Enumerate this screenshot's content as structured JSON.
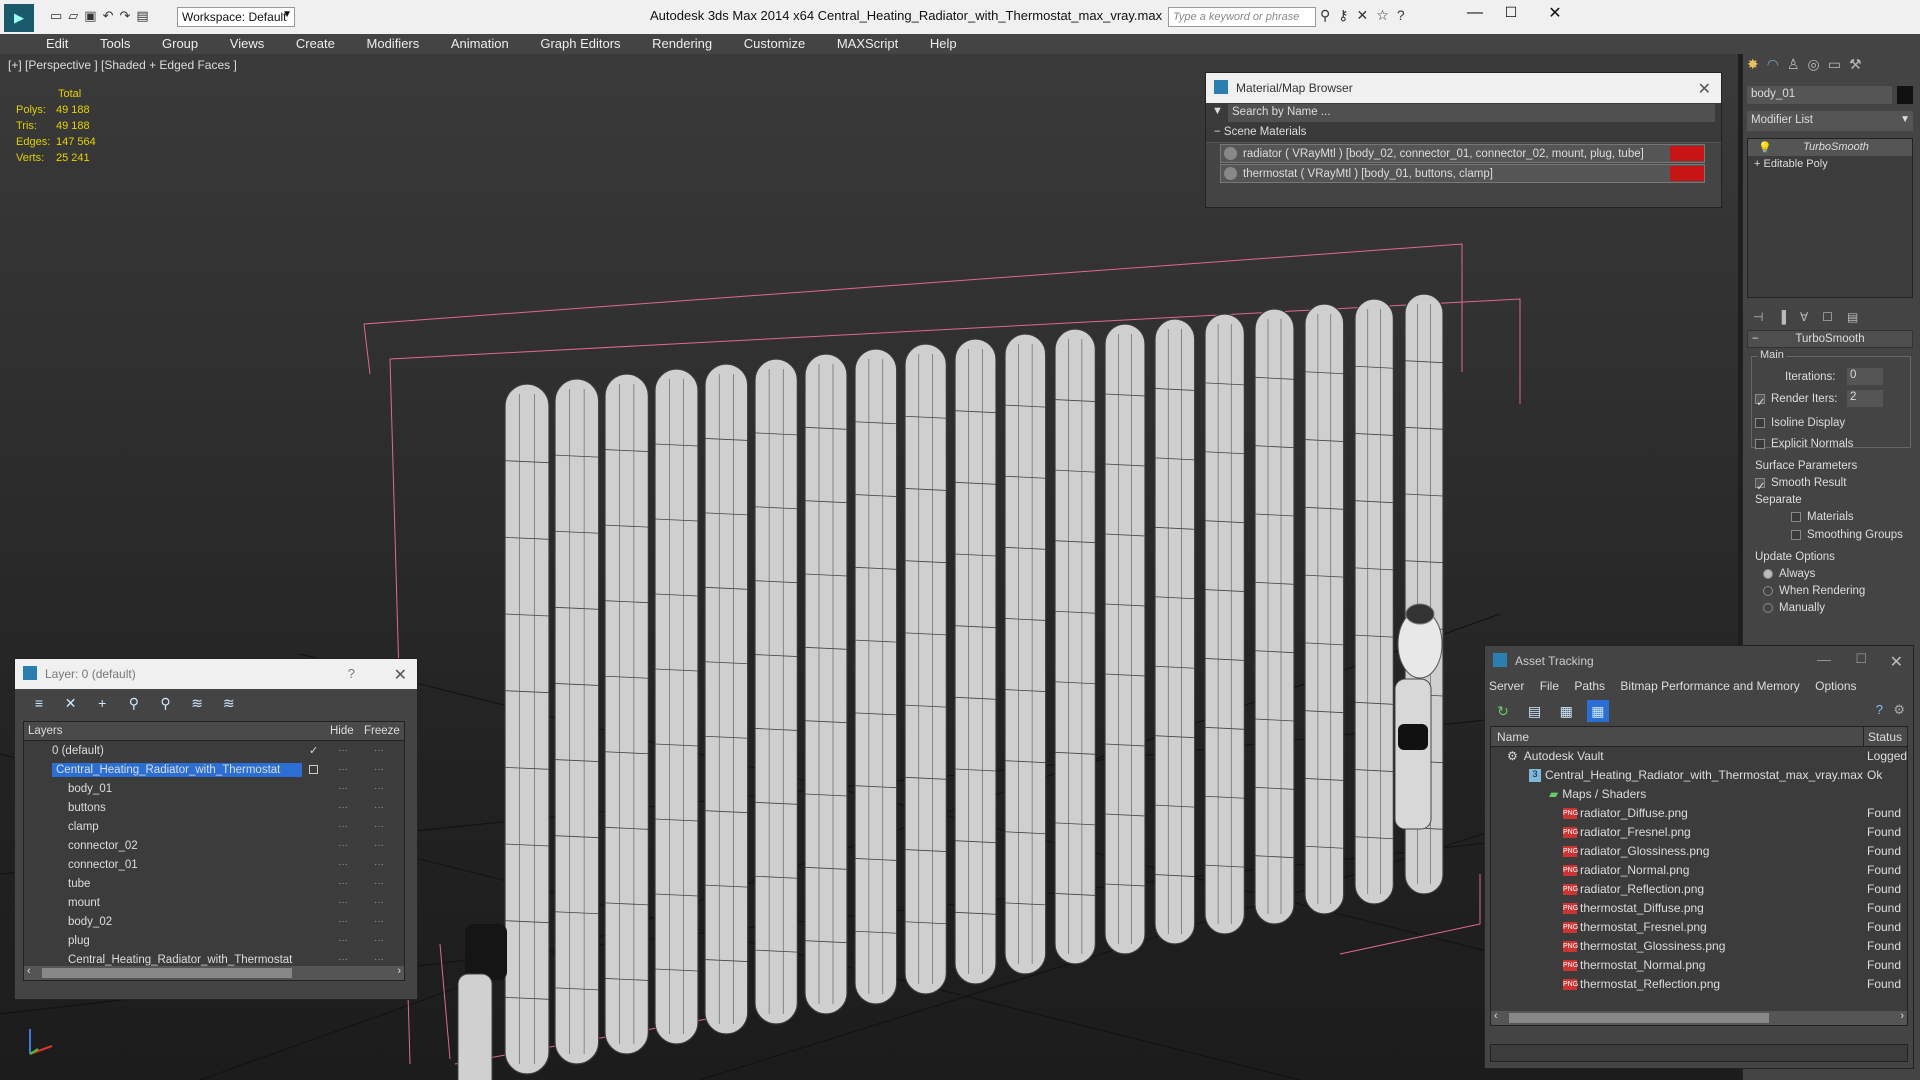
{
  "window": {
    "title": "Autodesk 3ds Max  2014 x64      Central_Heating_Radiator_with_Thermostat_max_vray.max",
    "workspace": "Workspace: Default",
    "search_placeholder": "Type a keyword or phrase"
  },
  "menu": [
    "Edit",
    "Tools",
    "Group",
    "Views",
    "Create",
    "Modifiers",
    "Animation",
    "Graph Editors",
    "Rendering",
    "Customize",
    "MAXScript",
    "Help"
  ],
  "viewport": {
    "label": "[+] [Perspective ] [Shaded + Edged Faces ]",
    "stats": {
      "header": "Total",
      "rows": [
        {
          "k": "Polys:",
          "v": "49 188"
        },
        {
          "k": "Tris:",
          "v": "49 188"
        },
        {
          "k": "Edges:",
          "v": "147 564"
        },
        {
          "k": "Verts:",
          "v": "25 241"
        }
      ]
    }
  },
  "material_browser": {
    "title": "Material/Map Browser",
    "search": "Search by Name ...",
    "section": "Scene Materials",
    "items": [
      "radiator  ( VRayMtl )  [body_02, connector_01, connector_02, mount, plug, tube]",
      "thermostat  ( VRayMtl )  [body_01, buttons, clamp]"
    ],
    "swatch_color": "#c81414"
  },
  "layer_panel": {
    "title": "Layer: 0 (default)",
    "help": "?",
    "col_layers": "Layers",
    "col_hide": "Hide",
    "col_freeze": "Freeze",
    "rows": [
      "0 (default)",
      "Central_Heating_Radiator_with_Thermostat",
      "body_01",
      "buttons",
      "clamp",
      "connector_02",
      "connector_01",
      "tube",
      "mount",
      "body_02",
      "plug",
      "Central_Heating_Radiator_with_Thermostat"
    ]
  },
  "command_panel": {
    "object_name": "body_01",
    "modifier_list": "Modifier List",
    "stack": [
      "TurboSmooth",
      "Editable Poly"
    ],
    "rollout": "TurboSmooth",
    "main": "Main",
    "iterations_label": "Iterations:",
    "iterations": "0",
    "render_iters_label": "Render Iters:",
    "render_iters": "2",
    "isoline": "Isoline Display",
    "explicit": "Explicit Normals",
    "surface": "Surface Parameters",
    "smooth_result": "Smooth Result",
    "separate": "Separate",
    "materials": "Materials",
    "smoothing_groups": "Smoothing Groups",
    "update": "Update Options",
    "always": "Always",
    "when_rendering": "When Rendering",
    "manually": "Manually"
  },
  "asset_tracking": {
    "title": "Asset Tracking",
    "menu": [
      "Server",
      "File",
      "Paths",
      "Bitmap Performance and Memory",
      "Options"
    ],
    "col_name": "Name",
    "col_status": "Status",
    "vault": {
      "name": "Autodesk Vault",
      "status": "Logged"
    },
    "file": {
      "name": "Central_Heating_Radiator_with_Thermostat_max_vray.max",
      "status": "Ok"
    },
    "maps": "Maps / Shaders",
    "files": [
      {
        "name": "radiator_Diffuse.png",
        "status": "Found"
      },
      {
        "name": "radiator_Fresnel.png",
        "status": "Found"
      },
      {
        "name": "radiator_Glossiness.png",
        "status": "Found"
      },
      {
        "name": "radiator_Normal.png",
        "status": "Found"
      },
      {
        "name": "radiator_Reflection.png",
        "status": "Found"
      },
      {
        "name": "thermostat_Diffuse.png",
        "status": "Found"
      },
      {
        "name": "thermostat_Fresnel.png",
        "status": "Found"
      },
      {
        "name": "thermostat_Glossiness.png",
        "status": "Found"
      },
      {
        "name": "thermostat_Normal.png",
        "status": "Found"
      },
      {
        "name": "thermostat_Reflection.png",
        "status": "Found"
      }
    ]
  }
}
